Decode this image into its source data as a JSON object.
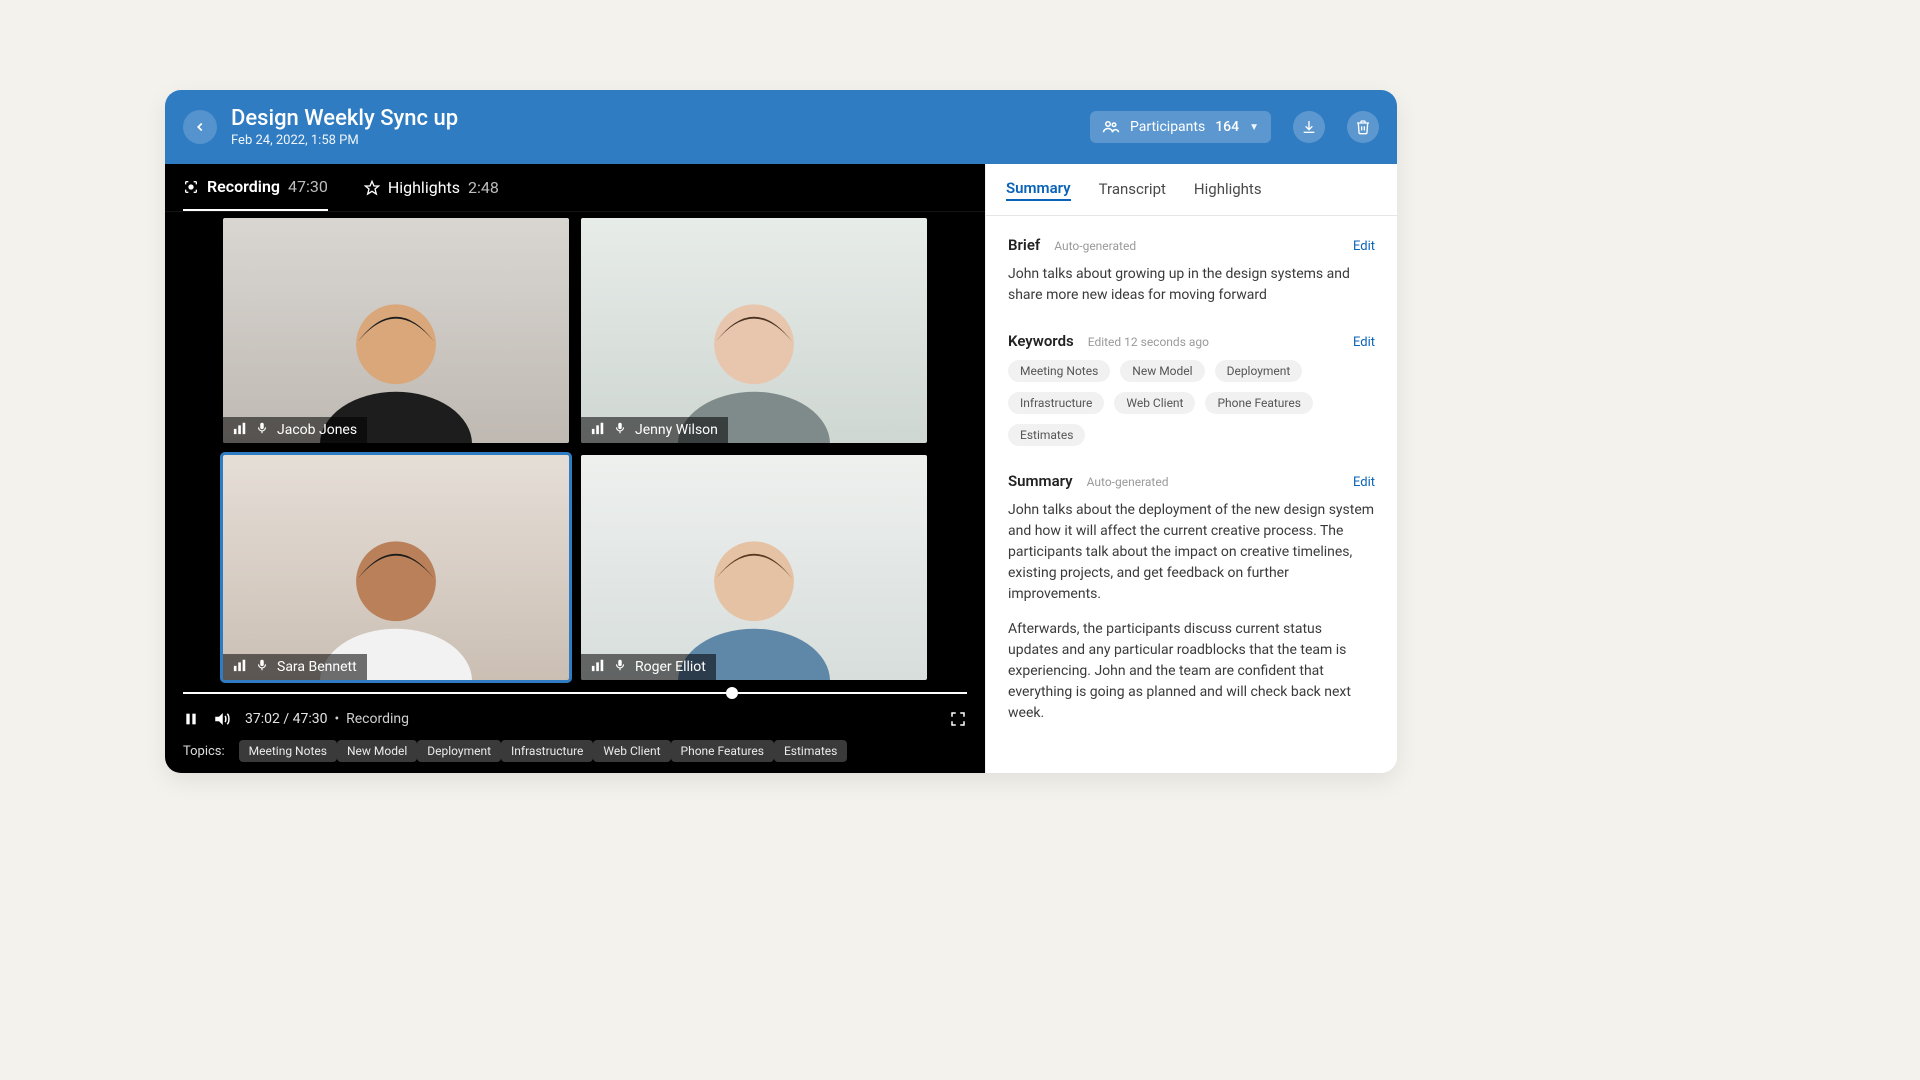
{
  "header": {
    "title": "Design Weekly Sync up",
    "subtitle": "Feb 24, 2022, 1:58 PM",
    "participants_label": "Participants",
    "participants_count": "164"
  },
  "left_tabs": {
    "recording_label": "Recording",
    "recording_time": "47:30",
    "highlights_label": "Highlights",
    "highlights_time": "2:48"
  },
  "tiles": [
    {
      "name": "Jacob Jones",
      "speaking": false
    },
    {
      "name": "Jenny Wilson",
      "speaking": false
    },
    {
      "name": "Sara Bennett",
      "speaking": true
    },
    {
      "name": "Roger Elliot",
      "speaking": false
    }
  ],
  "player": {
    "progress_pct": 70,
    "time_current": "37:02",
    "time_total": "47:30",
    "status": "Recording"
  },
  "topics_label": "Topics:",
  "topics": [
    "Meeting Notes",
    "New Model",
    "Deployment",
    "Infrastructure",
    "Web Client",
    "Phone Features",
    "Estimates"
  ],
  "right_tabs": [
    "Summary",
    "Transcript",
    "Highlights"
  ],
  "right_active_tab": "Summary",
  "brief": {
    "title": "Brief",
    "meta": "Auto-generated",
    "edit": "Edit",
    "text": "John talks about growing up in the design systems and share more new ideas for moving forward"
  },
  "keywords": {
    "title": "Keywords",
    "meta": "Edited 12 seconds ago",
    "edit": "Edit",
    "items": [
      "Meeting Notes",
      "New Model",
      "Deployment",
      "Infrastructure",
      "Web Client",
      "Phone Features",
      "Estimates"
    ]
  },
  "summary": {
    "title": "Summary",
    "meta": "Auto-generated",
    "edit": "Edit",
    "p1": "John talks about the deployment of the new design system and how it will affect the current creative process. The participants talk about the impact on creative timelines, existing projects, and get feedback on further improvements.",
    "p2": "Afterwards, the participants discuss current status updates and any particular roadblocks that the team is experiencing. John and the team are confident that everything is going as planned and will check back next week."
  }
}
